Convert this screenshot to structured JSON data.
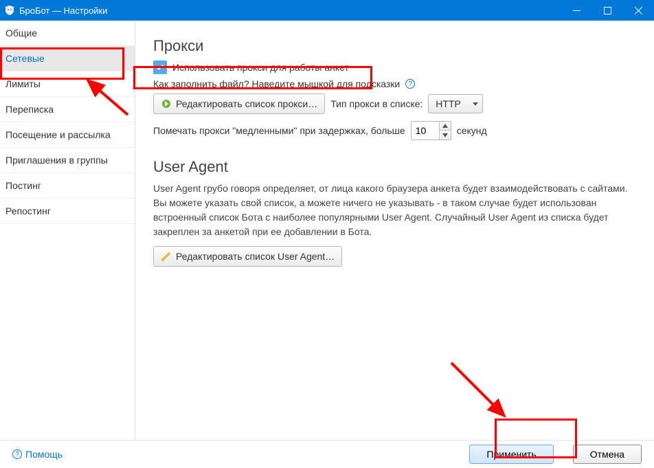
{
  "window": {
    "title": "БроБот — Настройки"
  },
  "sidebar": {
    "items": [
      {
        "label": "Общие"
      },
      {
        "label": "Сетевые",
        "active": true
      },
      {
        "label": "Лимиты"
      },
      {
        "label": "Переписка"
      },
      {
        "label": "Посещение и рассылка"
      },
      {
        "label": "Приглашения в группы"
      },
      {
        "label": "Постинг"
      },
      {
        "label": "Репостинг"
      }
    ]
  },
  "proxy": {
    "heading": "Прокси",
    "use_checkbox_label": "Использовать прокси для работы анкет",
    "fill_hint": "Как заполнить файл? Наведите мышкой для подсказки",
    "edit_list_button": "Редактировать список прокси…",
    "type_label": "Тип прокси в списке:",
    "type_value": "HTTP",
    "mark_slow_prefix": "Помечать прокси \"медленными\" при задержках, больше",
    "mark_slow_value": "10",
    "mark_slow_suffix": "секунд"
  },
  "user_agent": {
    "heading": "User Agent",
    "paragraph": "User Agent грубо говоря определяет, от лица какого браузера анкета будет взаимодействовать с сайтами. Вы можете указать свой список, а можете ничего не указывать - в таком случае будет использован встроенный список Бота с наиболее популярными User Agent. Случайный User Agent из списка будет закреплен за анкетой при ее добавлении в Бота.",
    "edit_list_button": "Редактировать список User Agent…"
  },
  "footer": {
    "help": "Помощь",
    "apply": "Применить",
    "cancel": "Отмена"
  }
}
